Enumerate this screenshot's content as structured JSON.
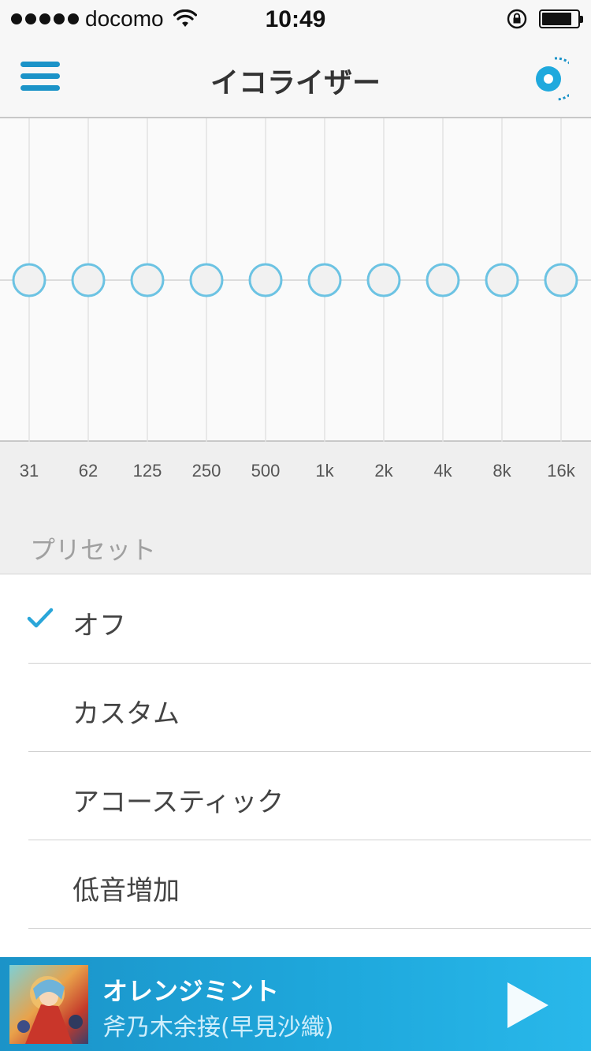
{
  "status_bar": {
    "carrier": "docomo",
    "time": "10:49",
    "signal_bars": 5,
    "battery_level": 0.85
  },
  "nav": {
    "title": "イコライザー",
    "left_icon": "hamburger-menu-icon",
    "right_icon": "app-logo-icon",
    "accent_color": "#1b93c8"
  },
  "equalizer": {
    "bands": [
      {
        "label": "31",
        "gain": 0
      },
      {
        "label": "62",
        "gain": 0
      },
      {
        "label": "125",
        "gain": 0
      },
      {
        "label": "250",
        "gain": 0
      },
      {
        "label": "500",
        "gain": 0
      },
      {
        "label": "1k",
        "gain": 0
      },
      {
        "label": "2k",
        "gain": 0
      },
      {
        "label": "4k",
        "gain": 0
      },
      {
        "label": "8k",
        "gain": 0
      },
      {
        "label": "16k",
        "gain": 0
      }
    ],
    "knob_color": "#6cc3e3"
  },
  "presets": {
    "header": "プリセット",
    "items": [
      {
        "label": "オフ",
        "selected": true
      },
      {
        "label": "カスタム",
        "selected": false
      },
      {
        "label": "アコースティック",
        "selected": false
      },
      {
        "label": "低音増加",
        "selected": false
      }
    ]
  },
  "now_playing": {
    "title": "オレンジミント",
    "artist": "斧乃木余接(早見沙織)",
    "play_icon": "play-icon"
  }
}
